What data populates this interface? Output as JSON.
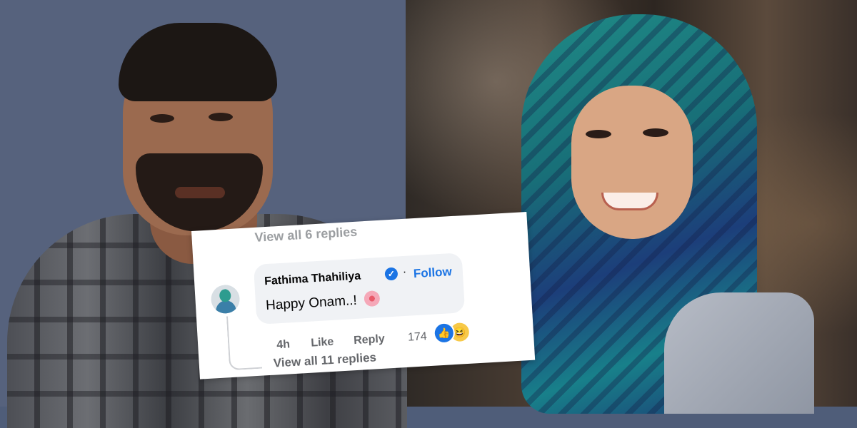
{
  "comment_card": {
    "ghost_replies_text": "View all 6 replies",
    "author_name": "Fathima Thahiliya",
    "verified_badge": "✓",
    "separator": "·",
    "follow_label": "Follow",
    "comment_text": "Happy Onam..!",
    "time_ago": "4h",
    "like_label": "Like",
    "reply_label": "Reply",
    "reaction_count": "174",
    "view_replies_label": "View all 11 replies"
  },
  "colors": {
    "facebook_blue": "#1b74e4",
    "meta_gray": "#65676b",
    "bubble_bg": "#f0f2f5"
  },
  "icons": {
    "verified": "verified-badge-icon",
    "like_reaction": "like-reaction-icon",
    "haha_reaction": "haha-reaction-icon",
    "flower_emoji": "flower-emoji-icon"
  }
}
